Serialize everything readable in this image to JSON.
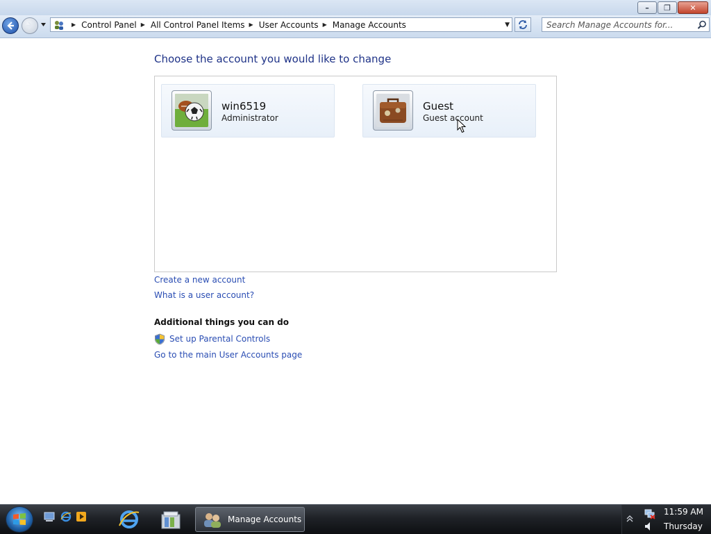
{
  "window": {
    "minimize_glyph": "–",
    "maximize_glyph": "❐",
    "close_glyph": "✕"
  },
  "navbar": {
    "breadcrumbs": [
      "Control Panel",
      "All Control Panel Items",
      "User Accounts",
      "Manage Accounts"
    ],
    "search_placeholder": "Search Manage Accounts for..."
  },
  "main": {
    "title": "Choose the account you would like to change",
    "accounts": [
      {
        "name": "win6519",
        "type": "Administrator",
        "avatar": "soccer-ball-picture"
      },
      {
        "name": "Guest",
        "type": "Guest account",
        "avatar": "briefcase-picture"
      }
    ],
    "links": {
      "create": "Create a new account",
      "what_is": "What is a user account?"
    },
    "additional": {
      "heading": "Additional things you can do",
      "parental": "Set up Parental Controls",
      "main_page": "Go to the main User Accounts page"
    }
  },
  "taskbar": {
    "active_task": "Manage Accounts",
    "time": "11:59 AM",
    "day": "Thursday"
  },
  "colors": {
    "link": "#2a4db3",
    "title": "#1e3287",
    "taskbar": "#1f2227"
  }
}
